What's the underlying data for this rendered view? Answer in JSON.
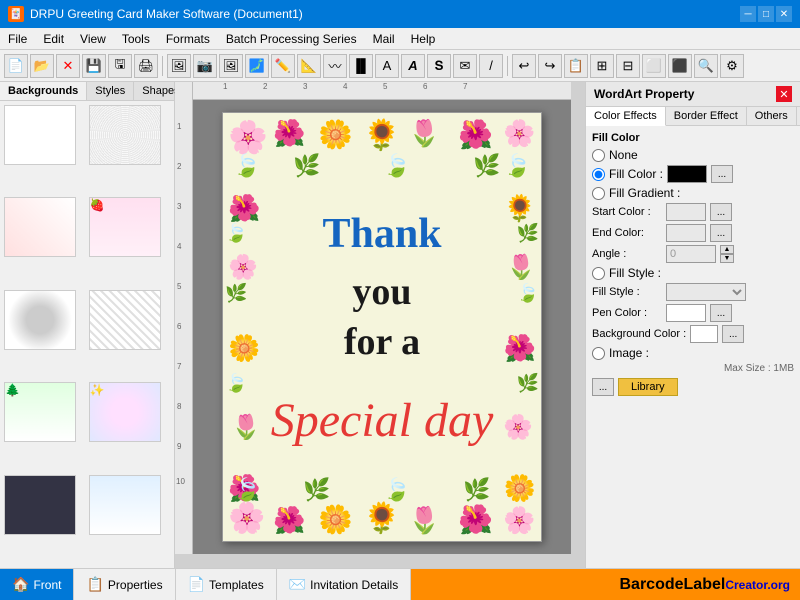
{
  "titlebar": {
    "icon": "🎴",
    "title": "DRPU Greeting Card Maker Software (Document1)",
    "minimize": "─",
    "maximize": "□",
    "close": "✕"
  },
  "menubar": {
    "items": [
      "File",
      "Edit",
      "View",
      "Tools",
      "Formats",
      "Batch Processing Series",
      "Mail",
      "Help"
    ]
  },
  "leftpanel": {
    "tabs": [
      "Backgrounds",
      "Styles",
      "Shapes"
    ]
  },
  "rightpanel": {
    "title": "WordArt Property",
    "close": "✕",
    "tabs": [
      "Color Effects",
      "Border Effect",
      "Others"
    ],
    "fillColor": {
      "label": "Fill Color",
      "noneLabel": "None",
      "fillColorLabel": "Fill Color :",
      "fillGradientLabel": "Fill Gradient :",
      "startColorLabel": "Start Color :",
      "endColorLabel": "End Color:",
      "angleLabel": "Angle :",
      "angleValue": "0",
      "fillStyleLabel1": "Fill Style :",
      "fillStyleLabel2": "Fill Style :",
      "penColorLabel": "Pen Color :",
      "bgColorLabel": "Background Color :",
      "imageLabel": "Image :",
      "maxSize": "Max Size : 1MB",
      "browseBtn": "...",
      "libraryBtn": "Library"
    }
  },
  "card": {
    "line1": "Thank",
    "line2": "you",
    "line3": "for a",
    "line4": "Special day"
  },
  "statusbar": {
    "items": [
      {
        "icon": "🏠",
        "label": "Front"
      },
      {
        "icon": "📋",
        "label": "Properties"
      },
      {
        "icon": "📄",
        "label": "Templates"
      },
      {
        "icon": "✉️",
        "label": "Invitation Details"
      }
    ],
    "barcode": "BarcodeLabel",
    "barcodeBlue": "Creator.org"
  }
}
